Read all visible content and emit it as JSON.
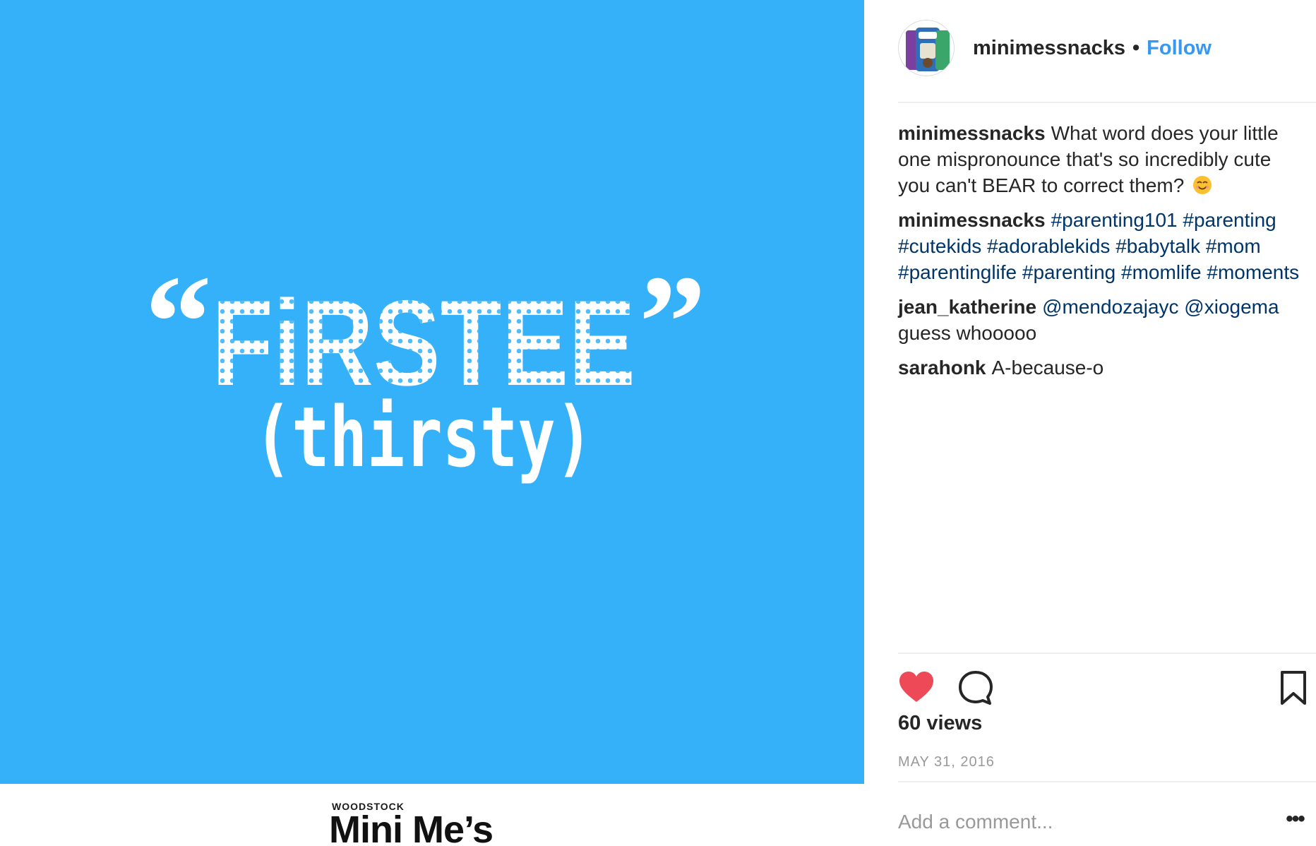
{
  "post_image": {
    "quote_open": "“",
    "word": "FiRSTEE",
    "quote_close": "”",
    "meaning": "(thirsty)",
    "background_color": "#35b1fa",
    "logo_small": "WOODSTOCK",
    "logo_main": "Mini Me’s"
  },
  "header": {
    "avatar_icon": "brand-logo-avatar",
    "username": "minimessnacks",
    "separator": "•",
    "follow_label": "Follow"
  },
  "comments": [
    {
      "user": "minimessnacks",
      "text": "What word does your little one mispronounce that's so incredibly cute you can't BEAR to correct them?",
      "emoji": "smiling-face-emoji"
    },
    {
      "user": "minimessnacks",
      "tags": [
        "#parenting101",
        "#parenting",
        "#cutekids",
        "#adorablekids",
        "#babytalk",
        "#mom",
        "#parentinglife",
        "#parenting",
        "#momlife",
        "#moments"
      ]
    },
    {
      "user": "jean_katherine",
      "mentions": [
        "@mendozajayc",
        "@xiogema"
      ],
      "text": "guess whooooo"
    },
    {
      "user": "sarahonk",
      "text": "A-because-o"
    }
  ],
  "actions": {
    "like_icon": "heart-icon",
    "like_color": "#ed4956",
    "comment_icon": "comment-icon",
    "save_icon": "bookmark-icon"
  },
  "views": "60 views",
  "date": "MAY 31, 2016",
  "add_comment_placeholder": "Add a comment...",
  "more_label": "•••"
}
